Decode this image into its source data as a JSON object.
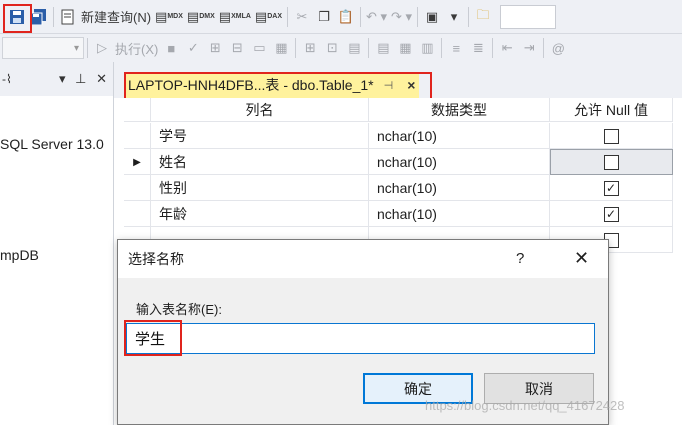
{
  "toolbar": {
    "new_query_label": "新建查询(N)",
    "mdx_label": "MDX",
    "dmx_label": "DMX",
    "xmla_label": "XMLA",
    "dax_label": "DAX",
    "execute_label": "执行(X)"
  },
  "left_panel": {
    "server_text": "SQL Server 13.0",
    "db_text": "mpDB"
  },
  "tab": {
    "title": "LAPTOP-HNH4DFB...表 - dbo.Table_1*",
    "pin_icon": "pin-icon",
    "close_label": "×"
  },
  "grid": {
    "headers": [
      "列名",
      "数据类型",
      "允许 Null 值"
    ],
    "rows": [
      {
        "name": "学号",
        "type": "nchar(10)",
        "allow_null": false,
        "current": false
      },
      {
        "name": "姓名",
        "type": "nchar(10)",
        "allow_null": false,
        "current": true
      },
      {
        "name": "性别",
        "type": "nchar(10)",
        "allow_null": true,
        "current": false
      },
      {
        "name": "年龄",
        "type": "nchar(10)",
        "allow_null": true,
        "current": false
      }
    ]
  },
  "dialog": {
    "title": "选择名称",
    "help_label": "?",
    "close_label": "✕",
    "prompt": "输入表名称(E):",
    "input_value": "学生",
    "ok_label": "确定",
    "cancel_label": "取消"
  },
  "watermark": "https://blog.csdn.net/qq_41672428",
  "colors": {
    "highlight": "#e0241d",
    "tab_bg": "#fff29d",
    "accent": "#0078d7"
  }
}
